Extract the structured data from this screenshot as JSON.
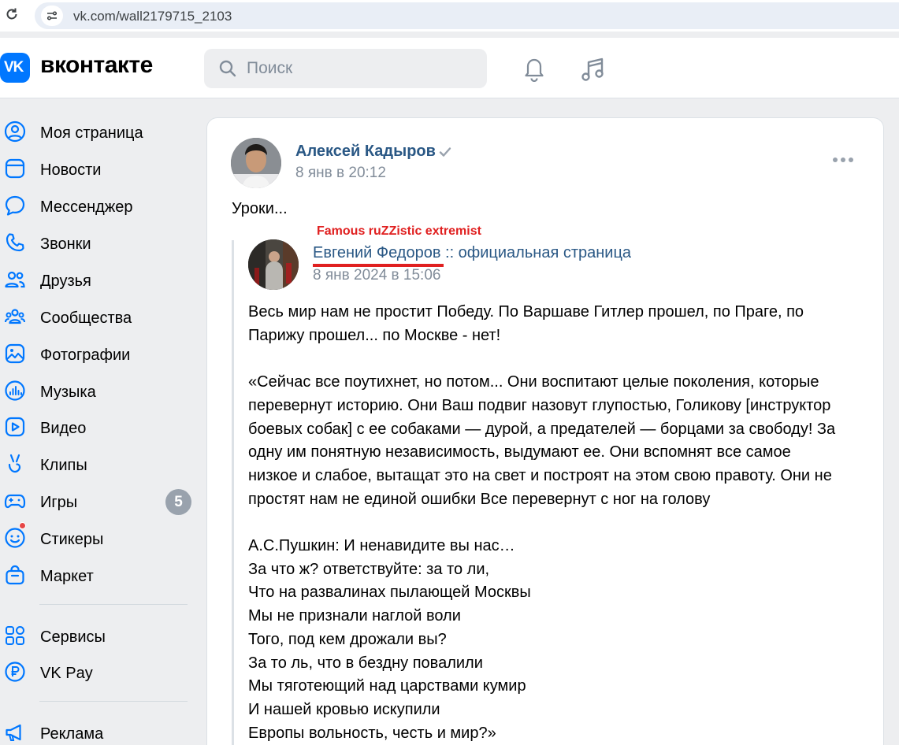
{
  "browser": {
    "url": "vk.com/wall2179715_2103"
  },
  "header": {
    "logo_text": "VK",
    "brand": "вконтакте",
    "search_placeholder": "Поиск"
  },
  "sidebar": {
    "items": [
      {
        "label": "Моя страница",
        "icon": "user-circle-icon"
      },
      {
        "label": "Новости",
        "icon": "news-icon"
      },
      {
        "label": "Мессенджер",
        "icon": "message-icon"
      },
      {
        "label": "Звонки",
        "icon": "phone-icon"
      },
      {
        "label": "Друзья",
        "icon": "friends-icon"
      },
      {
        "label": "Сообщества",
        "icon": "communities-icon"
      },
      {
        "label": "Фотографии",
        "icon": "photo-icon"
      },
      {
        "label": "Музыка",
        "icon": "music-icon"
      },
      {
        "label": "Видео",
        "icon": "video-icon"
      },
      {
        "label": "Клипы",
        "icon": "clips-icon"
      },
      {
        "label": "Игры",
        "icon": "gamepad-icon",
        "badge": "5"
      },
      {
        "label": "Стикеры",
        "icon": "sticker-icon"
      },
      {
        "label": "Маркет",
        "icon": "market-icon"
      },
      {
        "label": "Сервисы",
        "icon": "services-icon"
      },
      {
        "label": "VK Pay",
        "icon": "ruble-icon"
      },
      {
        "label": "Реклама",
        "icon": "megaphone-icon"
      }
    ]
  },
  "post": {
    "author": "Алексей Кадыров",
    "date": "8 янв в 20:12",
    "text": "Уроки...",
    "repost": {
      "annotation": "Famous ruZZistic extremist",
      "author": "Евгений Федоров",
      "author_suffix": " :: официальная страница",
      "date": "8 янв 2024 в 15:06",
      "paragraphs": [
        [
          "Весь мир нам не простит Победу. По Варшаве Гитлер прошел, по Праге, по",
          "Парижу прошел... по Москве - нет!"
        ],
        [
          "«Сейчас все поутихнет, но потом... Они воспитают целые поколения, которые",
          "перевернут историю. Они Ваш подвиг назовут глупостью, Голикову [инструктор",
          "боевых собак] с ее собаками — дурой, а предателей — борцами за свободу! За",
          "одну им понятную независимость, выдумают ее. Они вспомнят все самое",
          "низкое и слабое, вытащат это на свет и построят на этом свою правоту. Они не",
          "простят нам не единой ошибки Все перевернут с ног на голову"
        ],
        [
          "А.С.Пушкин: И ненавидите вы нас…",
          "За что ж? ответствуйте: за то ли,",
          "Что на развалинах пылающей Москвы",
          "Мы не признали наглой воли",
          "Того, под кем дрожали вы?",
          "За то ль, что в бездну повалили",
          "Мы тяготеющий над царствами кумир",
          "И нашей кровью искупили",
          "Европы вольность, честь и мир?»"
        ]
      ]
    }
  },
  "colors": {
    "accent": "#0077ff",
    "link": "#2a5885",
    "muted": "#818c99",
    "annotation": "#e02020"
  }
}
